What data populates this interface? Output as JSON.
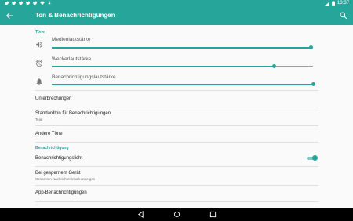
{
  "status_bar": {
    "notification_icons": [
      "twitter-icon",
      "twitter-icon",
      "twitter-icon",
      "twitter-icon",
      "twitter-icon",
      "wifi-icon",
      "download-icon"
    ],
    "time": "13:37",
    "color": "#26a69a"
  },
  "app_bar": {
    "title": "Ton & Benachrichtigungen",
    "back_icon": "arrow-back-icon",
    "search_icon": "search-icon"
  },
  "sections": {
    "tones": "Töne",
    "notifications": "Benachrichtigung"
  },
  "sliders": {
    "media": {
      "label": "Medienlautstärke",
      "value": 0.993,
      "icon": "volume-icon"
    },
    "alarm": {
      "label": "Weckerlautstärke",
      "value": 0.85,
      "icon": "alarm-icon"
    },
    "notification": {
      "label": "Benachrichtigungslautstärke",
      "value": 1.0,
      "icon": "bell-icon"
    }
  },
  "rows": {
    "interruptions": {
      "title": "Unterbrechungen"
    },
    "default_tone": {
      "title": "Standardton für Benachrichtigungen",
      "subtitle": "Tejat"
    },
    "other_tones": {
      "title": "Andere Töne"
    },
    "notification_light": {
      "title": "Benachrichtigungslicht",
      "enabled": true
    },
    "locked_device": {
      "title": "Bei gesperrtem Gerät",
      "subtitle": "Gesamten Nachrichteninhalt anzeigen"
    },
    "app_notifications": {
      "title": "App-Benachrichtigungen"
    }
  },
  "accent_color": "#26a69a"
}
